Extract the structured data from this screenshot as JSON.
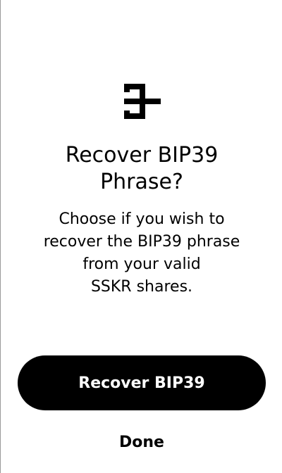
{
  "app": {
    "logo_icon": "seedtool-logo-icon"
  },
  "dialog": {
    "title": "Recover BIP39\nPhrase?",
    "description": "Choose if you wish to\nrecover the BIP39 phrase\nfrom your valid\nSSKR shares."
  },
  "actions": {
    "primary_label": "Recover BIP39",
    "secondary_label": "Done"
  },
  "colors": {
    "primary_button_bg": "#000000",
    "primary_button_text": "#ffffff",
    "text": "#000000",
    "background": "#ffffff"
  }
}
